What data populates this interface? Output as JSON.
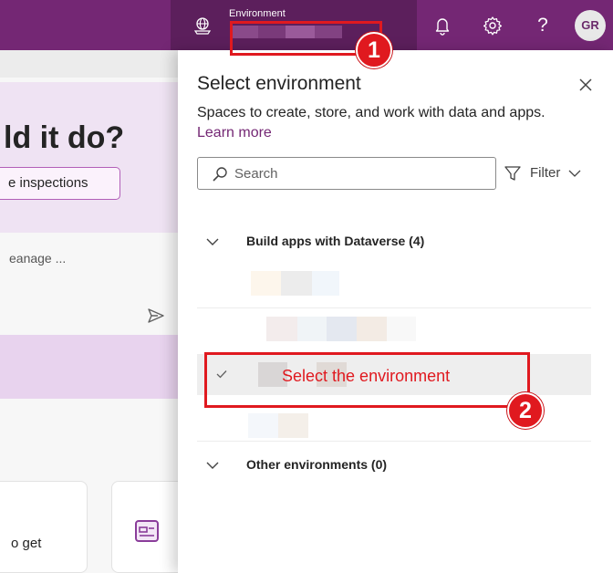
{
  "topbar": {
    "environment_label": "Environment",
    "help_glyph": "?",
    "avatar_initials": "GR",
    "icons": [
      "globe-icon",
      "bell-icon",
      "gear-icon",
      "help-icon"
    ],
    "colors": {
      "bar": "#742774",
      "env_area": "#5c1f5c"
    }
  },
  "background_page": {
    "heading": "ld it do?",
    "chip_label": "e inspections",
    "manage_text": "eanage ...",
    "card_text": "o get"
  },
  "panel": {
    "title": "Select environment",
    "description": "Spaces to create, store, and work with data and apps.",
    "learn_more": "Learn more",
    "search_placeholder": "Search",
    "filter_label": "Filter",
    "groups": [
      {
        "label": "Build apps with Dataverse (4)"
      },
      {
        "label": "Other environments (0)"
      }
    ]
  },
  "annotations": {
    "badge_1": "1",
    "badge_2": "2",
    "callout_text": "Select the environment",
    "color": "#e0191f"
  }
}
